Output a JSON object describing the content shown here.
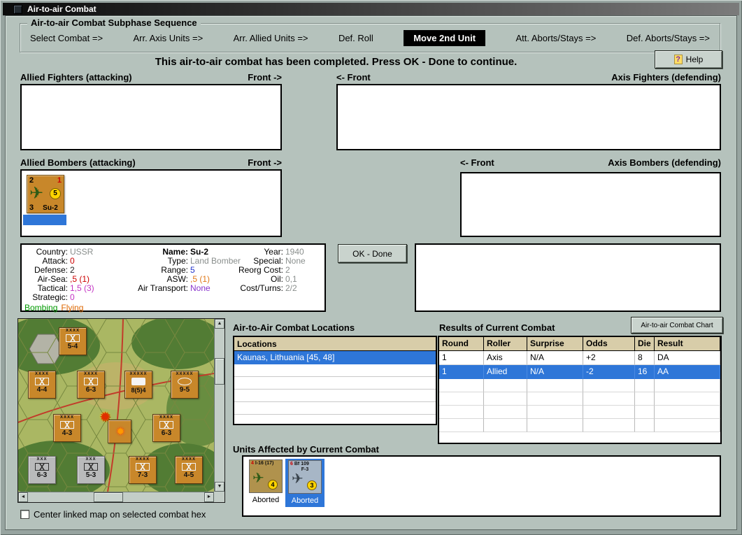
{
  "window": {
    "title": "Air-to-air Combat"
  },
  "icons": {
    "help": "?",
    "plane": "✈",
    "explosion": "✹",
    "up": "▲",
    "down": "▼",
    "left": "◄",
    "right": "►"
  },
  "sequence": {
    "title": "Air-to-air Combat Subphase Sequence",
    "steps": [
      {
        "label": "Select Combat =>"
      },
      {
        "label": "Arr. Axis Units =>"
      },
      {
        "label": "Arr. Allied Units =>"
      },
      {
        "label": "Def. Roll"
      },
      {
        "label": "Move 2nd Unit",
        "active": true
      },
      {
        "label": "Att. Aborts/Stays =>"
      },
      {
        "label": "Def. Aborts/Stays =>"
      }
    ]
  },
  "message": "This air-to-air combat has been completed.  Press OK - Done to continue.",
  "help": {
    "label": "Help"
  },
  "sections": {
    "allied_fighters": "Allied Fighters (attacking)",
    "allied_fighters_front": "Front ->",
    "axis_fighters_front": "<- Front",
    "axis_fighters": "Axis Fighters (defending)",
    "allied_bombers": "Allied Bombers (attacking)",
    "allied_bombers_front": "Front ->",
    "axis_bombers_front": "<- Front",
    "axis_bombers": "Axis Bombers (defending)"
  },
  "su2_counter": {
    "top_left": "2",
    "top_right": "1",
    "strength": "5",
    "bottom_left": "3",
    "name": "Su-2"
  },
  "unit_info": {
    "col1": [
      {
        "label": "Country:",
        "value": "USSR"
      },
      {
        "label": "Attack:",
        "value": "0"
      },
      {
        "label": "Defense:",
        "value": "2"
      },
      {
        "label": "Air-Sea:",
        "value": ",5 (1)"
      },
      {
        "label": "Tactical:",
        "value": "1,5 (3)"
      },
      {
        "label": "Strategic:",
        "value": "0"
      }
    ],
    "status_left": "Bombing",
    "status_right": "Flying",
    "col2": [
      {
        "label": "Name:",
        "value": "Su-2"
      },
      {
        "label": "Type:",
        "value": "Land Bomber"
      },
      {
        "label": "Range:",
        "value": "5"
      },
      {
        "label": "ASW:",
        "value": ",5 (1)"
      },
      {
        "label": "Air Transport:",
        "value": "None"
      }
    ],
    "col3": [
      {
        "label": "Year:",
        "value": "1940"
      },
      {
        "label": "Special:",
        "value": "None"
      },
      {
        "label": "Reorg Cost:",
        "value": "2"
      },
      {
        "label": "Oil:",
        "value": "0,1"
      },
      {
        "label": "Cost/Turns:",
        "value": "2/2"
      }
    ]
  },
  "ok_button": "OK - Done",
  "map": {
    "checkbox_label": "Center linked map on selected combat hex",
    "counters": [
      {
        "size": "XXXX",
        "value": "5-4"
      },
      {
        "size": "XXXX",
        "value": "4-4"
      },
      {
        "size": "XXXX",
        "value": "6-3"
      },
      {
        "size": "XXXXX",
        "value": "8(5)4"
      },
      {
        "size": "XXXXX",
        "value": "9-5"
      },
      {
        "size": "XXXX",
        "value": "4-3"
      },
      {
        "size": "XXXX",
        "value": "6-3"
      },
      {
        "size": "XXX",
        "value": "6-3"
      },
      {
        "size": "XXX",
        "value": "5-3"
      },
      {
        "size": "XXXX",
        "value": "7-3"
      },
      {
        "size": "XXXX",
        "value": "4-5"
      }
    ]
  },
  "locations": {
    "title": "Air-to-Air Combat Locations",
    "header": "Locations",
    "rows": [
      "Kaunas, Lithuania [45, 48]"
    ]
  },
  "results": {
    "title": "Results of Current Combat",
    "chart_button": "Air-to-air Combat Chart",
    "headers": [
      "Round",
      "Roller",
      "Surprise",
      "Odds",
      "Die",
      "Result"
    ],
    "rows": [
      [
        "1",
        "Axis",
        "N/A",
        "+2",
        "8",
        "DA"
      ],
      [
        "1",
        "Allied",
        "N/A",
        "-2",
        "16",
        "AA"
      ]
    ]
  },
  "affected": {
    "title": "Units Affected by Current Combat",
    "units": [
      {
        "num": "4",
        "name": "I-16 (17)",
        "name2": "",
        "strength": "4",
        "status": "Aborted",
        "selected": false
      },
      {
        "num": "6",
        "name": "Bf 109",
        "name2": "F-3",
        "strength": "3",
        "status": "Aborted",
        "selected": true
      }
    ]
  },
  "colors": {
    "selection_blue": "#2e76d8",
    "soviet_counter_tan": "#c8872a",
    "german_counter_gray_blue": "#a7b6c6",
    "strength_circle_yellow": "#ffd400",
    "table_header_beige": "#d8cda9",
    "active_step_bg": "#000000",
    "attack_red": "#cc0000",
    "tactical_magenta": "#c333c3",
    "bombing_green": "#009900",
    "flying_orange": "#dd6600",
    "range_blue": "#2233cc",
    "transport_purple": "#8833cc",
    "muted_gray": "#8a8f8d"
  }
}
